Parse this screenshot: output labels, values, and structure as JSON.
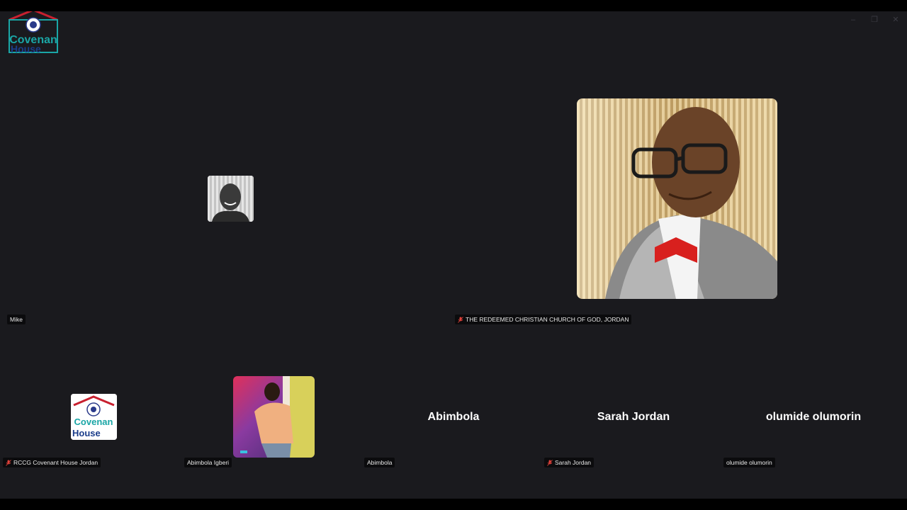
{
  "window": {
    "controls": [
      {
        "name": "minimize",
        "glyph": "–"
      },
      {
        "name": "restore",
        "glyph": "❐"
      },
      {
        "name": "close",
        "glyph": "✕"
      }
    ]
  },
  "logo": {
    "line1": "Covenan",
    "line2": "House"
  },
  "participants": [
    {
      "id": "mike",
      "label": "Mike",
      "muted": false
    },
    {
      "id": "rccg-jordan",
      "label": "THE REDEEMED CHRISTIAN CHURCH OF GOD, JORDAN",
      "muted": true
    },
    {
      "id": "rccg-covenant",
      "label": "RCCG Covenant House Jordan",
      "muted": true
    },
    {
      "id": "abimbola-igberi",
      "label": "Abimbola Igberi",
      "muted": false
    },
    {
      "id": "abimbola",
      "label": "Abimbola",
      "muted": false,
      "display_name": "Abimbola"
    },
    {
      "id": "sarah-jordan",
      "label": "Sarah Jordan",
      "muted": true,
      "display_name": "Sarah Jordan"
    },
    {
      "id": "olumide",
      "label": "olumide olumorin",
      "muted": false,
      "display_name": "olumide olumorin"
    }
  ],
  "colors": {
    "background": "#1a1a1e",
    "mute_red": "#e0413a",
    "logo_teal": "#1aa6a6",
    "logo_red": "#c8202f"
  }
}
